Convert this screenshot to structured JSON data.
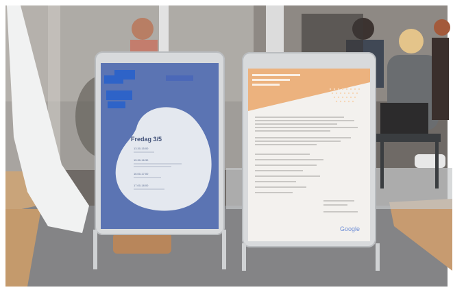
{
  "left_sign": {
    "title": "Fredag 3/5",
    "times": [
      "13.30-15.00",
      "15.30-16.30",
      "16.00-17.00",
      "17.00-18.00"
    ]
  },
  "right_sign": {
    "brand": "Google"
  },
  "colors": {
    "left_panel": "#5b74b3",
    "left_blob": "#e4e8ef",
    "left_accent": "#2e63c8",
    "right_banner": "#ecb27e",
    "right_panel": "#f3f1ee",
    "frame": "#d8dadc"
  }
}
